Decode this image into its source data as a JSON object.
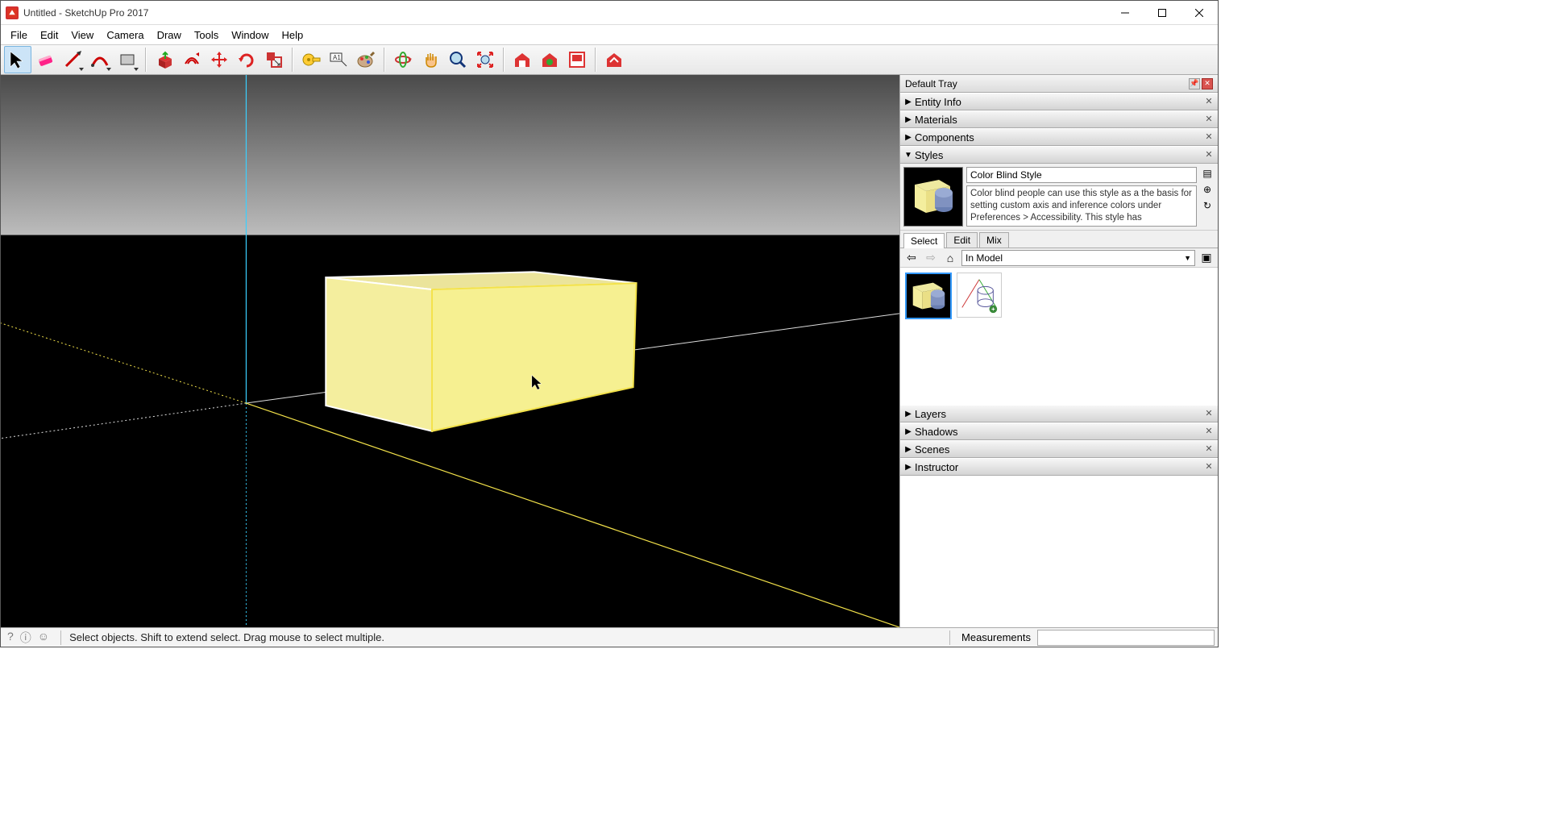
{
  "window": {
    "title": "Untitled - SketchUp Pro 2017"
  },
  "menu": [
    "File",
    "Edit",
    "View",
    "Camera",
    "Draw",
    "Tools",
    "Window",
    "Help"
  ],
  "toolbar": {
    "groups": [
      [
        {
          "id": "select",
          "active": true
        },
        {
          "id": "eraser"
        },
        {
          "id": "line",
          "dd": true
        },
        {
          "id": "arc",
          "dd": true
        },
        {
          "id": "rect",
          "dd": true
        }
      ],
      [
        {
          "id": "pushpull"
        },
        {
          "id": "offset"
        },
        {
          "id": "move"
        },
        {
          "id": "rotate"
        },
        {
          "id": "scale"
        }
      ],
      [
        {
          "id": "tape"
        },
        {
          "id": "text"
        },
        {
          "id": "paint"
        }
      ],
      [
        {
          "id": "orbit"
        },
        {
          "id": "pan"
        },
        {
          "id": "zoom"
        },
        {
          "id": "zoom-extents"
        }
      ],
      [
        {
          "id": "warehouse"
        },
        {
          "id": "ext-warehouse"
        },
        {
          "id": "layout"
        }
      ],
      [
        {
          "id": "advanced"
        }
      ]
    ]
  },
  "tray": {
    "title": "Default Tray",
    "panels_top": [
      {
        "label": "Entity Info",
        "expanded": false
      },
      {
        "label": "Materials",
        "expanded": false
      },
      {
        "label": "Components",
        "expanded": false
      },
      {
        "label": "Styles",
        "expanded": true
      }
    ],
    "styles": {
      "name": "Color Blind Style",
      "description": "Color blind people can use this style as a the basis for setting custom axis and inference colors under Preferences > Accessibility.  This style has",
      "tabs": [
        "Select",
        "Edit",
        "Mix"
      ],
      "active_tab": 0,
      "nav_label": "In Model"
    },
    "panels_bottom": [
      {
        "label": "Layers"
      },
      {
        "label": "Shadows"
      },
      {
        "label": "Scenes"
      },
      {
        "label": "Instructor"
      }
    ]
  },
  "status": {
    "hint": "Select objects. Shift to extend select. Drag mouse to select multiple.",
    "measurements_label": "Measurements"
  }
}
